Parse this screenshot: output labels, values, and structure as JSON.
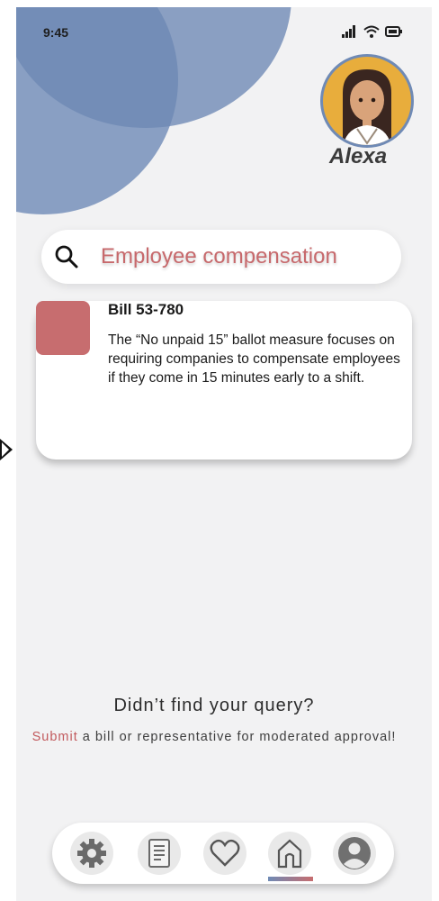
{
  "status_bar": {
    "time": "9:45"
  },
  "user": {
    "name": "Alexa"
  },
  "search": {
    "value": "Employee compensation"
  },
  "results": [
    {
      "title": "Bill 53-780",
      "description": "The “No unpaid 15” ballot measure focuses on requiring companies to compensate employees if they come in 15 minutes early to a shift."
    }
  ],
  "footer_prompt": {
    "heading": "Didn’t find your query?",
    "link_text": "Submit",
    "rest_text": " a bill or representative for moderated approval!"
  },
  "nav": {
    "items": [
      "gear-icon",
      "document-icon",
      "heart-icon",
      "home-icon",
      "profile-icon"
    ],
    "active": "home-icon"
  },
  "colors": {
    "accent_blue": "#6d88b3",
    "accent_red": "#c76d6f",
    "background": "#f2f2f3"
  }
}
